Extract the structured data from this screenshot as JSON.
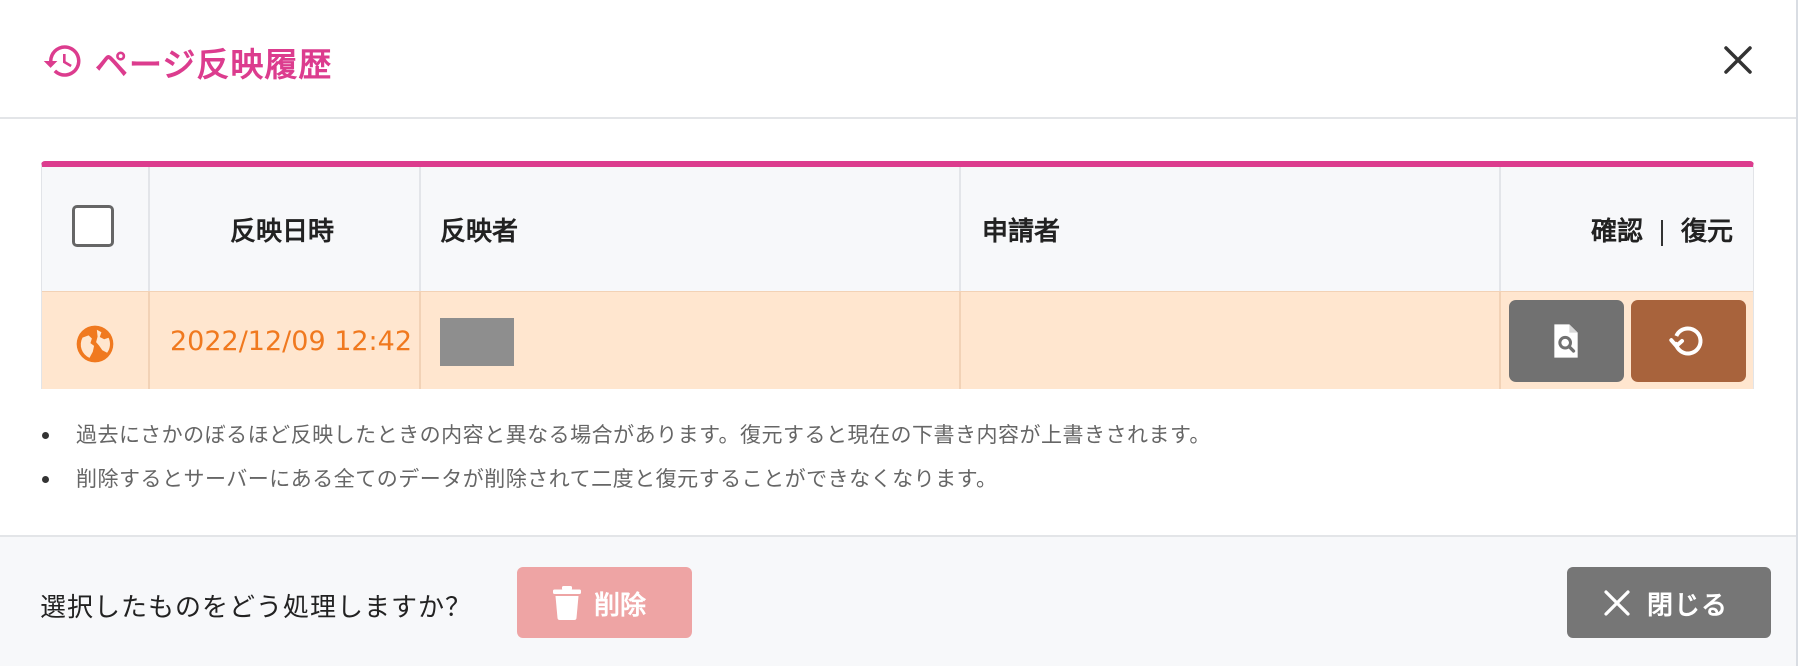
{
  "header": {
    "title": "ページ反映履歴",
    "icon": "history-icon",
    "accent_color": "#dc3c8e"
  },
  "table": {
    "columns": {
      "datetime": "反映日時",
      "publisher": "反映者",
      "applicant": "申請者",
      "confirm": "確認",
      "restore": "復元"
    },
    "rows": [
      {
        "status_icon": "globe-icon",
        "datetime": "2022/12/09 12:42",
        "publisher": "",
        "applicant": ""
      }
    ]
  },
  "notes": [
    "過去にさかのぼるほど反映したときの内容と異なる場合があります。復元すると現在の下書き内容が上書きされます。",
    "削除するとサーバーにある全てのデータが削除されて二度と復元することができなくなります。"
  ],
  "footer": {
    "prompt": "選択したものをどう処理しますか？",
    "delete_label": "削除",
    "close_label": "閉じる"
  }
}
